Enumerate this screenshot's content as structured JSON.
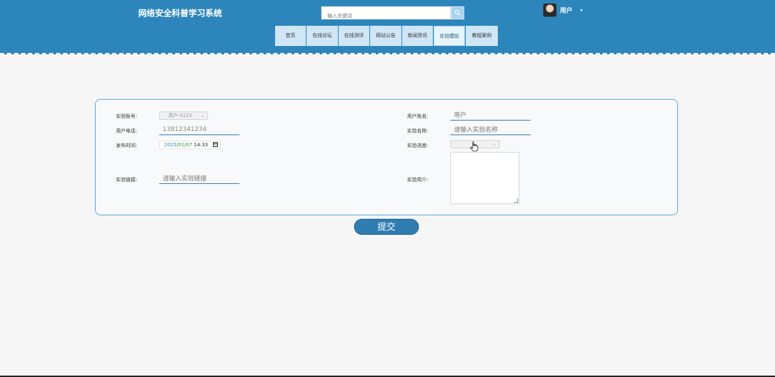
{
  "header": {
    "site_title": "网络安全科普学习系统",
    "search_placeholder": "输入关键词",
    "user_name": "用户",
    "user_caret": "▾"
  },
  "nav": {
    "items": [
      {
        "label": "首页",
        "active": false
      },
      {
        "label": "在线论坛",
        "active": false
      },
      {
        "label": "在线测评",
        "active": false
      },
      {
        "label": "网站公告",
        "active": false
      },
      {
        "label": "新闻资讯",
        "active": false
      },
      {
        "label": "实验模拟",
        "active": true
      },
      {
        "label": "教程案例",
        "active": false
      }
    ]
  },
  "form": {
    "account_label": "实验账号:",
    "account_value": "用户-II123",
    "username_label": "用户姓名:",
    "username_placeholder": "用户",
    "phone_label": "用户电话:",
    "phone_value": "13812341234",
    "exp_name_label": "实验名称:",
    "exp_name_placeholder": "请输入实验名称",
    "publish_time_label": "发布时间:",
    "date_year": "2025",
    "date_month": "01",
    "date_day": "07",
    "date_time": "14:33",
    "progress_label": "实验进度:",
    "progress_value": "",
    "link_label": "实验链接:",
    "link_placeholder": "请输入实验链接",
    "intro_label": "实验简介:",
    "intro_value": ""
  },
  "actions": {
    "submit_label": "提交"
  },
  "colors": {
    "header_bg": "#2d86bb",
    "panel_border": "#5aa7d3",
    "submit_bg": "#2f7db1"
  }
}
